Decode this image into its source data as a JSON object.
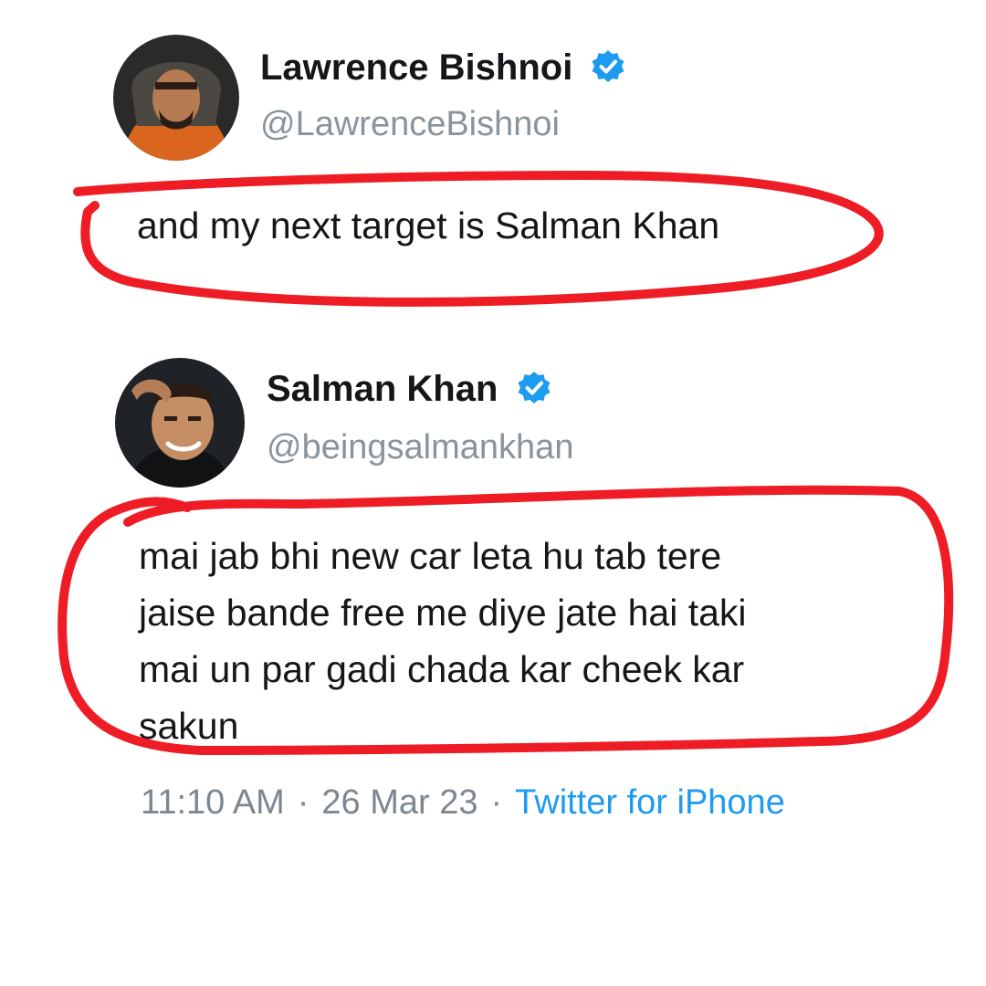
{
  "tweets": [
    {
      "author": {
        "name": "Lawrence Bishnoi",
        "handle": "@LawrenceBishnoi",
        "verified": true,
        "avatar_icon": "person-hoodie-avatar"
      },
      "text": "and my next target is Salman Khan"
    },
    {
      "author": {
        "name": "Salman Khan",
        "handle": "@beingsalmankhan",
        "verified": true,
        "avatar_icon": "person-avatar"
      },
      "text_lines": [
        "mai jab bhi new car leta hu tab tere",
        "jaise bande free me diye jate hai taki",
        "mai un par gadi chada kar cheek kar",
        "sakun"
      ],
      "meta": {
        "time": "11:10 AM",
        "date": "26 Mar 23",
        "source": "Twitter for iPhone",
        "separator": "·"
      }
    }
  ],
  "colors": {
    "verified_badge": "#1d9bf0",
    "highlight_scribble": "#ee1c25",
    "link": "#1d9bf0",
    "muted_text": "#8a949c"
  }
}
